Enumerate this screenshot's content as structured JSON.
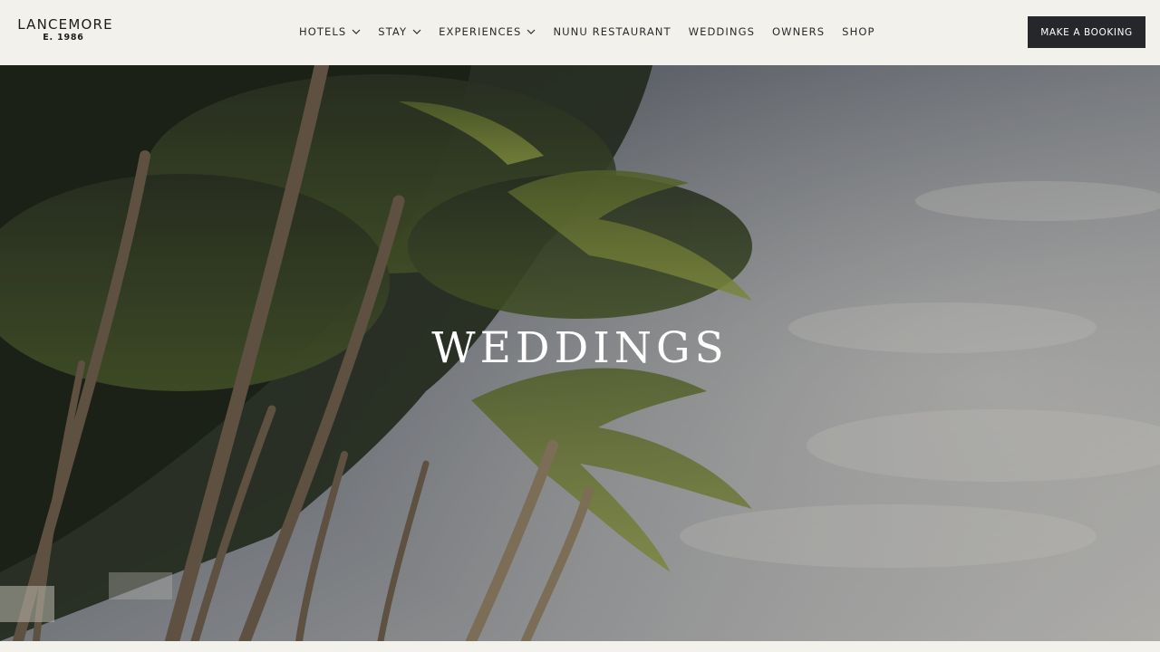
{
  "brand": {
    "name": "LANCEMORE",
    "established": "E. 1986"
  },
  "nav": {
    "items": [
      {
        "label": "HOTELS",
        "has_dropdown": true
      },
      {
        "label": "STAY",
        "has_dropdown": true
      },
      {
        "label": "EXPERIENCES",
        "has_dropdown": true
      },
      {
        "label": "NUNU RESTAURANT",
        "has_dropdown": false
      },
      {
        "label": "WEDDINGS",
        "has_dropdown": false
      },
      {
        "label": "OWNERS",
        "has_dropdown": false
      },
      {
        "label": "SHOP",
        "has_dropdown": false
      }
    ],
    "dropdown_icon": "chevron-down-icon"
  },
  "booking_button": {
    "label": "MAKE A BOOKING"
  },
  "hero": {
    "title": "WEDDINGS",
    "image": "palm-trees-beach-photo"
  },
  "colors": {
    "header_bg": "#f2f1ec",
    "button_bg": "#26272b",
    "text": "#2a2a2a",
    "hero_text": "#ffffff"
  }
}
